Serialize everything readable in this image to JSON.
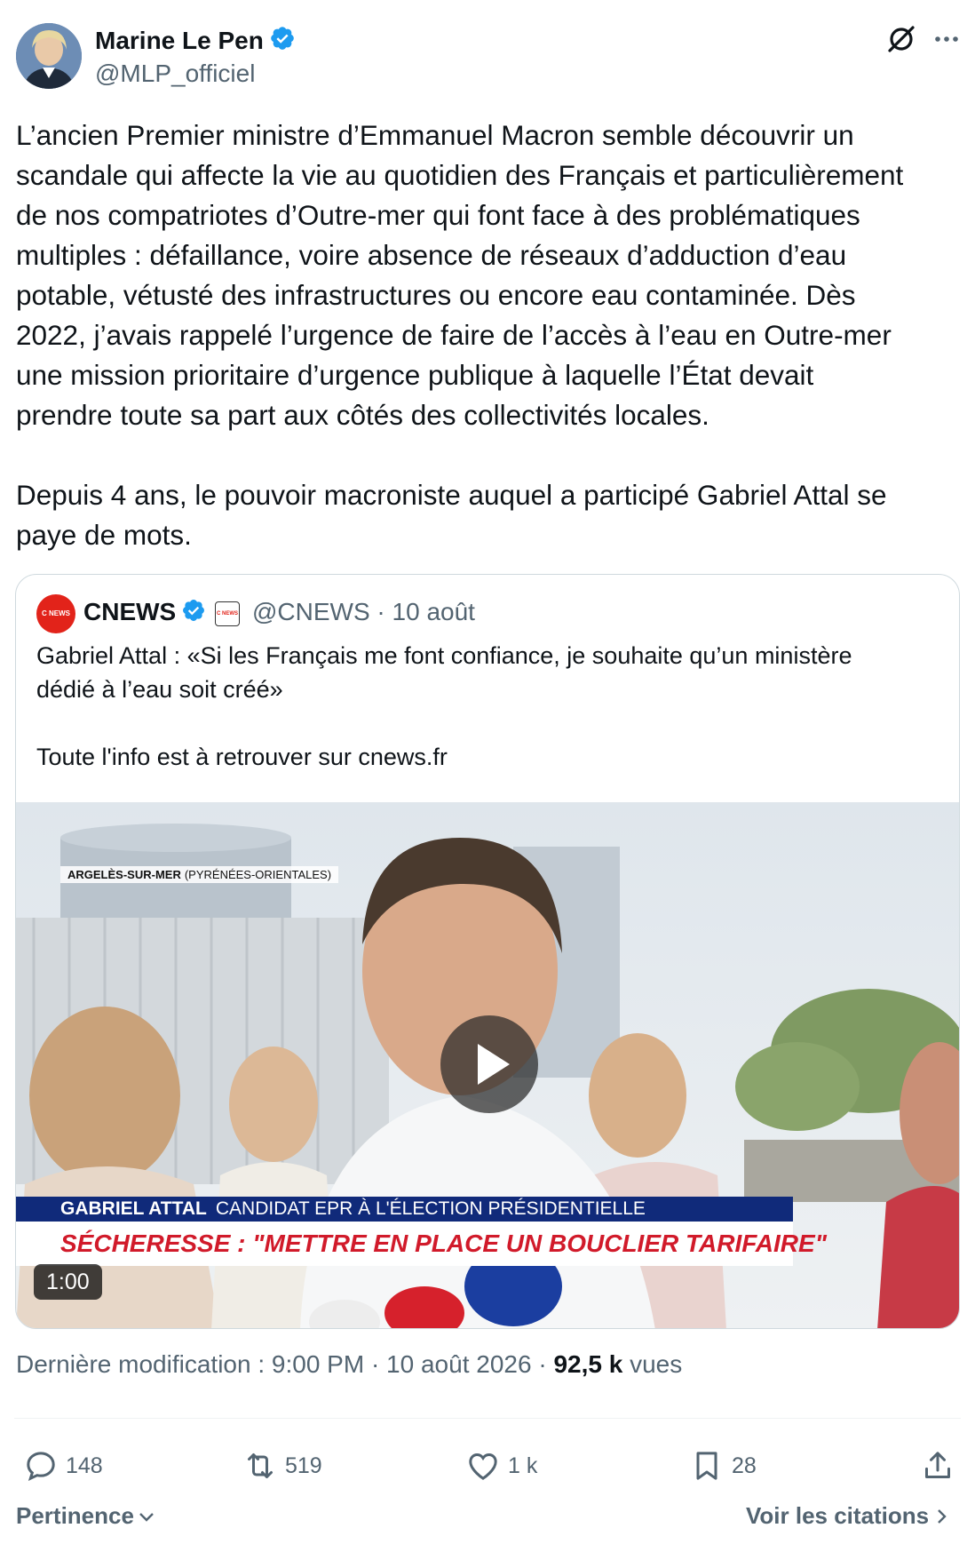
{
  "author": {
    "name": "Marine Le Pen",
    "handle": "@MLP_officiel",
    "verified_color": "#1d9bf0"
  },
  "tweet": {
    "text": "L’ancien Premier ministre d’Emmanuel Macron semble découvrir un\nscandale qui affecte la vie au quotidien des Français et particulièrement\nde nos compatriotes d’Outre-mer qui font face à des problématiques\nmultiples : défaillance, voire absence de réseaux d’adduction d’eau\npotable, vétusté des infrastructures ou encore eau contaminée. Dès\n2022, j’avais rappelé l’urgence de faire de l’accès à l’eau en Outre-mer\nune mission prioritaire d’urgence publique à laquelle l’État devait\nprendre toute sa part aux côtés des collectivités locales.\n\nDepuis 4 ans, le pouvoir macroniste auquel a participé Gabriel Attal se\npaye de mots."
  },
  "quoted": {
    "name": "CNEWS",
    "logo_text": "C NEWS",
    "handle_date": "@CNEWS · 10 août",
    "text": "Gabriel Attal : «Si les Français me font confiance, je souhaite qu’un ministère\ndédié à l’eau soit créé»\n\nToute l'info est à retrouver sur cnews.fr",
    "video": {
      "location_bold": "ARGELÈS-SUR-MER",
      "location_rest": "(PYRÉNÉES-ORIENTALES)",
      "banner_name": "GABRIEL ATTAL",
      "banner_role": "CANDIDAT EPR À L'ÉLECTION PRÉSIDENTIELLE",
      "headline": "SÉCHERESSE : \"METTRE EN PLACE UN BOUCLIER TARIFAIRE\"",
      "duration": "1:00"
    }
  },
  "meta": {
    "edited": "Dernière modification : 9:00 PM · 10 août 2026 · ",
    "views_count": "92,5 k",
    "views_label": " vues"
  },
  "actions": {
    "replies": "148",
    "reposts": "519",
    "likes": "1 k",
    "bookmarks": "28"
  },
  "footer": {
    "sort_label": "Pertinence",
    "quotes_label": "Voir les citations"
  },
  "colors": {
    "text": "#0f1419",
    "muted": "#536471",
    "border": "#cfd9de",
    "verified": "#1d9bf0",
    "cnews_red": "#e2231a"
  }
}
